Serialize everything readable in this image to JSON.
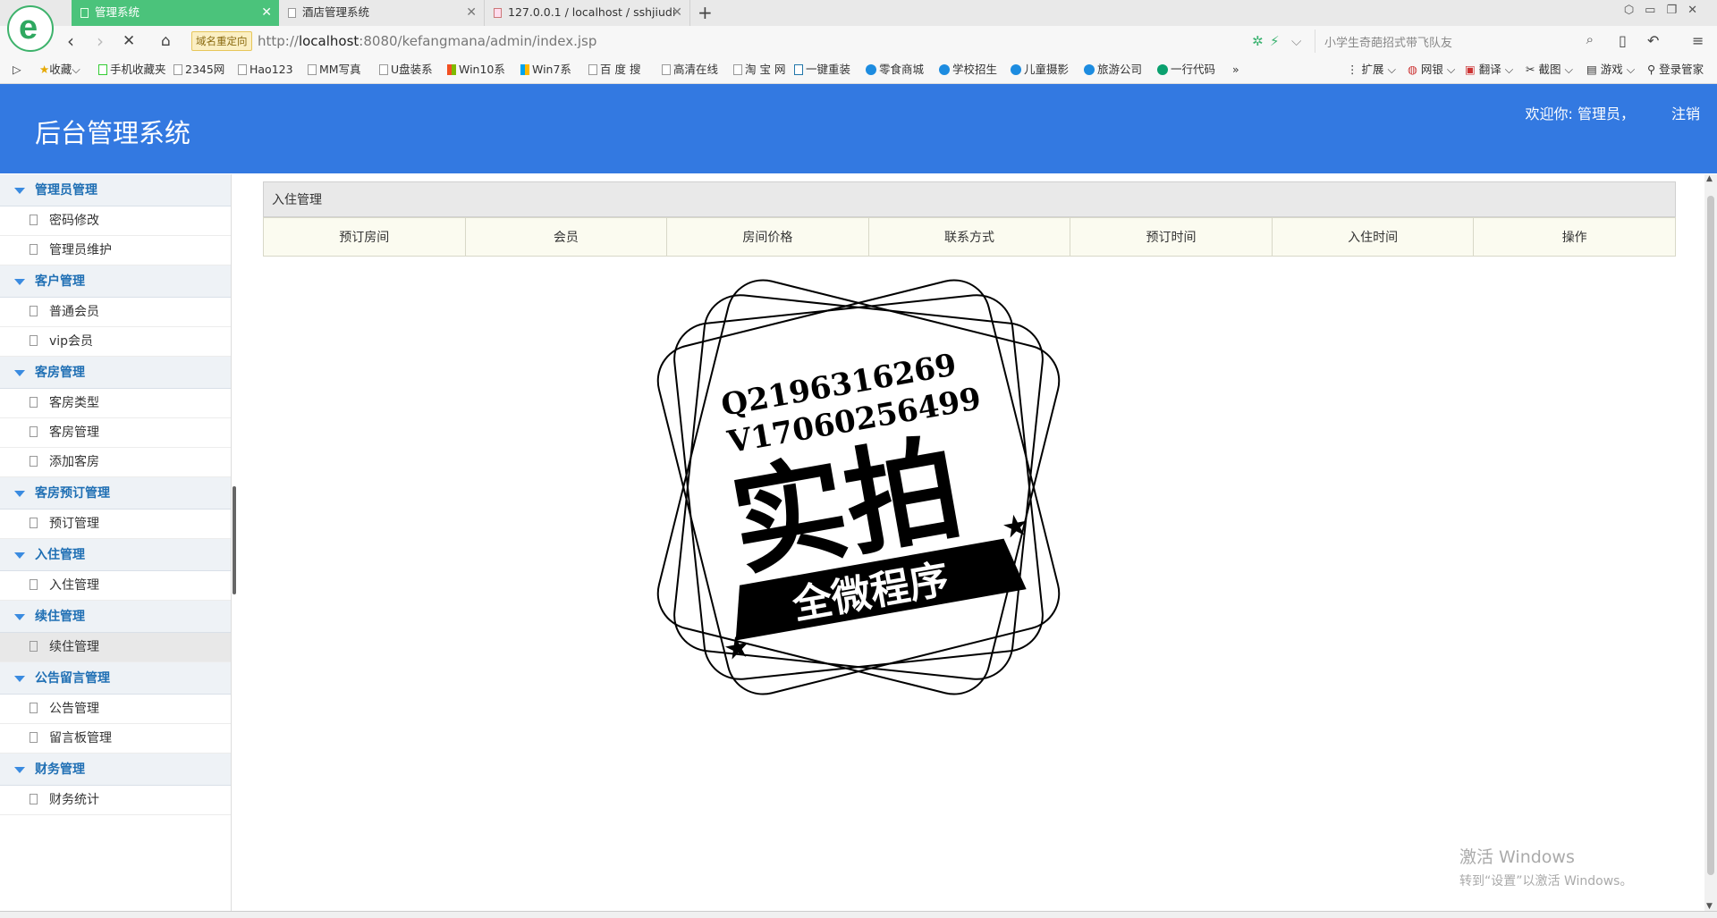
{
  "browser": {
    "tabs": [
      {
        "title": "管理系统",
        "active": true
      },
      {
        "title": "酒店管理系统",
        "active": false
      },
      {
        "title": "127.0.0.1 / localhost / sshjiudi",
        "active": false
      }
    ],
    "redirect_badge": "域名重定向",
    "url_prefix": "http://",
    "url_host": "localhost",
    "url_rest": ":8080/kefangmana/admin/index.jsp",
    "search_placeholder": "小学生奇葩招式带飞队友",
    "bookmarks": [
      "收藏",
      "手机收藏夹",
      "2345网",
      "Hao123",
      "MM写真",
      "U盘装系",
      "Win10系",
      "Win7系",
      "百 度 搜",
      "高清在线",
      "淘 宝 网",
      "一键重装",
      "零食商城",
      "学校招生",
      "儿童摄影",
      "旅游公司",
      "一行代码"
    ],
    "bookmarks_right": [
      "扩展",
      "网银",
      "翻译",
      "截图",
      "游戏",
      "登录管家"
    ]
  },
  "app": {
    "title": "后台管理系统",
    "welcome": "欢迎你: 管理员，",
    "logout": "注销"
  },
  "sidebar": {
    "groups": [
      {
        "label": "管理员管理",
        "items": [
          "密码修改",
          "管理员维护"
        ]
      },
      {
        "label": "客户管理",
        "items": [
          "普通会员",
          "vip会员"
        ]
      },
      {
        "label": "客房管理",
        "items": [
          "客房类型",
          "客房管理",
          "添加客房"
        ]
      },
      {
        "label": "客房预订管理",
        "items": [
          "预订管理"
        ]
      },
      {
        "label": "入住管理",
        "items": [
          "入住管理"
        ]
      },
      {
        "label": "续住管理",
        "items": [
          "续住管理"
        ]
      },
      {
        "label": "公告留言管理",
        "items": [
          "公告管理",
          "留言板管理"
        ]
      },
      {
        "label": "财务管理",
        "items": [
          "财务统计"
        ]
      }
    ]
  },
  "main": {
    "panel_title": "入住管理",
    "columns": [
      "预订房间",
      "会员",
      "房间价格",
      "联系方式",
      "预订时间",
      "入住时间",
      "操作"
    ]
  },
  "stamp": {
    "line1": "Q2196316269",
    "line2": "V17060256499",
    "big": "实拍",
    "banner": "全微程序"
  },
  "os": {
    "activate_title": "激活 Windows",
    "activate_sub": "转到“设置”以激活 Windows。"
  }
}
